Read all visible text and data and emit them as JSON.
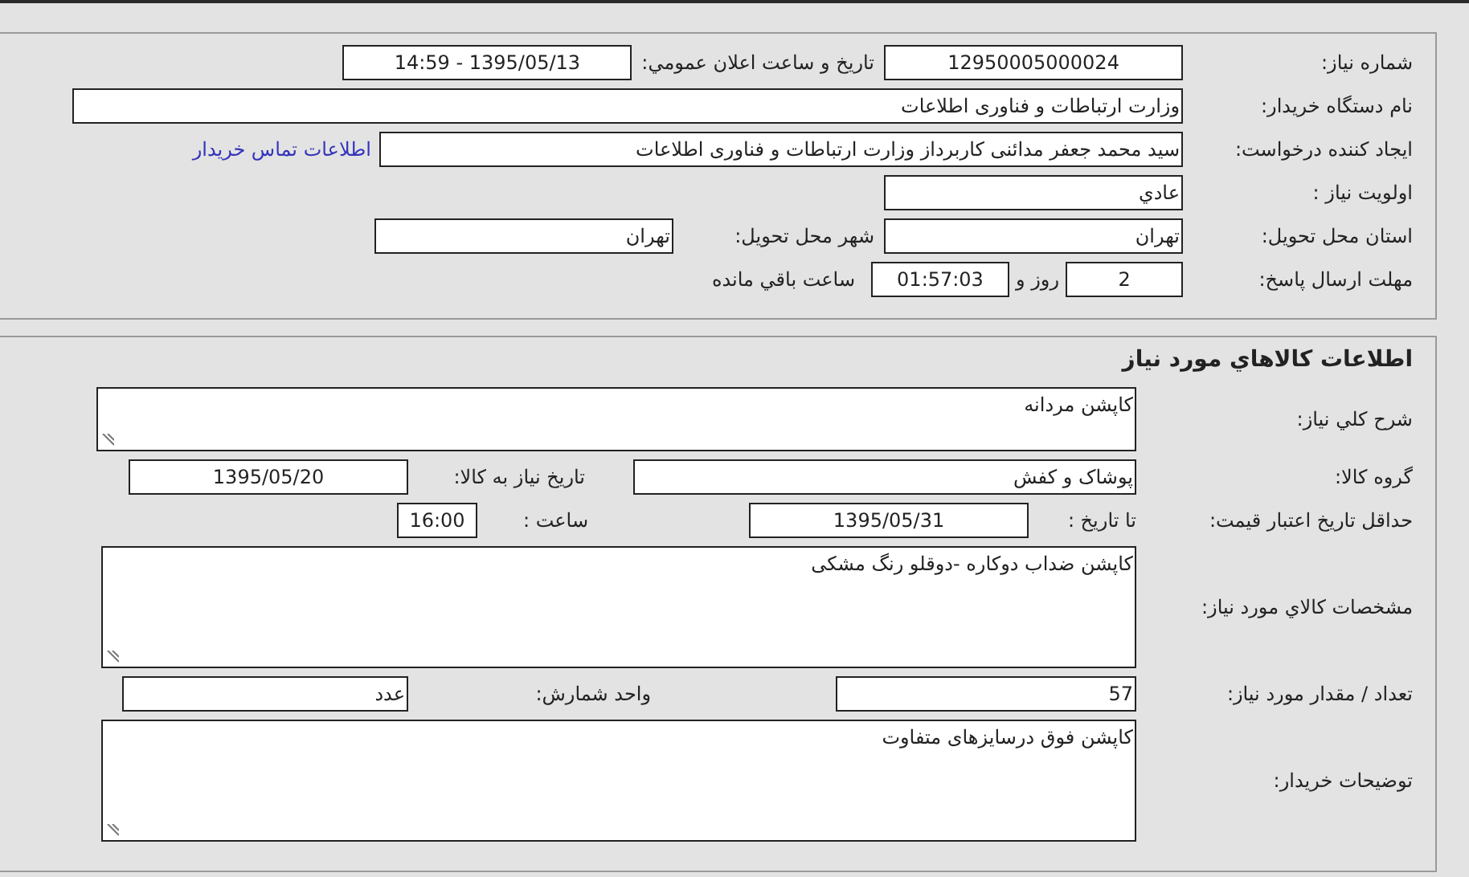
{
  "general": {
    "need_number": {
      "label": "شماره نیاز:",
      "value": "12950005000024"
    },
    "announce_datetime": {
      "label": "تاریخ و ساعت اعلان عمومي:",
      "value": "1395/05/13 - 14:59"
    },
    "buyer_org": {
      "label": "نام دستگاه خریدار:",
      "value": "وزارت ارتباطات و فناوری اطلاعات"
    },
    "requester": {
      "label": "ایجاد کننده درخواست:",
      "value": "سید محمد جعفر مدائنی کاربرداز وزارت ارتباطات و فناوری اطلاعات"
    },
    "buyer_contact_link": "اطلاعات تماس خریدار",
    "priority": {
      "label": "اولویت نیاز :",
      "value": "عادي"
    },
    "delivery_province": {
      "label": "استان محل تحویل:",
      "value": "تهران"
    },
    "delivery_city": {
      "label": "شهر محل تحویل:",
      "value": "تهران"
    },
    "response_deadline": {
      "label": "مهلت ارسال پاسخ:",
      "days": "2",
      "days_unit": "روز و",
      "time": "01:57:03",
      "time_unit": "ساعت باقي مانده"
    }
  },
  "goods": {
    "title": "اطلاعات کالاهاي مورد نیاز",
    "general_description": {
      "label": "شرح کلي نیاز:",
      "value": "کاپشن مردانه"
    },
    "goods_group": {
      "label": "گروه کالا:",
      "value": "پوشاک و کفش"
    },
    "need_date": {
      "label": "تاریخ نیاز به کالا:",
      "value": "1395/05/20"
    },
    "price_validity": {
      "label": "حداقل تاریخ اعتبار قیمت:",
      "until_label": "تا تاریخ :",
      "date": "1395/05/31",
      "time_label": "ساعت :",
      "time": "16:00"
    },
    "specifications": {
      "label": "مشخصات کالاي مورد نیاز:",
      "value": "کاپشن ضداب دوکاره -دوقلو رنگ مشکی"
    },
    "quantity": {
      "label": "تعداد / مقدار مورد نیاز:",
      "value": "57"
    },
    "unit": {
      "label": "واحد شمارش:",
      "value": "عدد"
    },
    "buyer_notes": {
      "label": "توضیحات خریدار:",
      "value": "کاپشن فوق درسایزهای متفاوت"
    }
  }
}
